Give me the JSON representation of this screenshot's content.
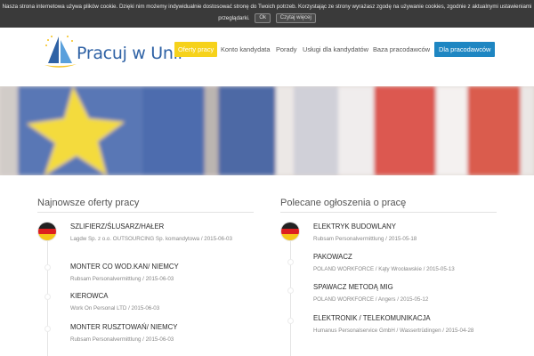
{
  "cookie": {
    "text_line1": "Nasza strona internetowa używa plików cookie. Dzięki nim możemy indywidualnie dostosować stronę do Twoich potrzeb. Korzystając ze strony wyrażasz zgodę na używanie cookies, zgodnie z aktualnymi ustawieniami",
    "text_line2": "przeglądarki.",
    "ok_label": "Ok",
    "more_label": "Czytaj więcej"
  },
  "header": {
    "logo_text": "Pracuj w Unii",
    "nav": [
      {
        "label": "Oferty pracy"
      },
      {
        "label": "Konto kandydata"
      },
      {
        "label": "Porady"
      },
      {
        "label": "Usługi dla kandydatów"
      },
      {
        "label": "Baza pracodawców"
      },
      {
        "label": "Dla pracodawców"
      }
    ]
  },
  "colors": {
    "nav_active": "#f6d21b",
    "nav_cta": "#1e86c2",
    "logo_blue": "#2f62a5"
  },
  "latest": {
    "title": "Najnowsze oferty pracy",
    "jobs": [
      {
        "title": "SZLIFIERZ/ŚLUSARZ/HAŁER",
        "meta": "Lagdw Sp. z o.o. OUTSOURCING Sp. komandytowa / 2015-06-03",
        "flag": "germany-flag-icon"
      },
      {
        "title": "MONTER CO WOD.KAN/ NIEMCY",
        "meta": "Rubsam Personalvermittlung / 2015-06-03"
      },
      {
        "title": "KIEROWCA",
        "meta": "Work On Personal LTD / 2015-06-03"
      },
      {
        "title": "MONTER RUSZTOWAŃ/ NIEMCY",
        "meta": "Rubsam Personalvermittlung / 2015-06-03"
      }
    ]
  },
  "recommended": {
    "title": "Polecane ogłoszenia o pracę",
    "jobs": [
      {
        "title": "ELEKTRYK BUDOWLANY",
        "meta": "Rubsam Personalvermittlung / 2015-05-18",
        "flag": "germany-flag-icon"
      },
      {
        "title": "PAKOWACZ",
        "meta": "POLAND WORKFORCE / Kąty Wrocławskie / 2015-05-13"
      },
      {
        "title": "SPAWACZ METODĄ MIG",
        "meta": "POLAND WORKFORCE / Angers / 2015-05-12"
      },
      {
        "title": "ELEKTRONIK / TELEKOMUNIKACJA",
        "meta": "Humanus Personalservice GmbH / Wassertrüdingen / 2015-04-28"
      }
    ]
  }
}
